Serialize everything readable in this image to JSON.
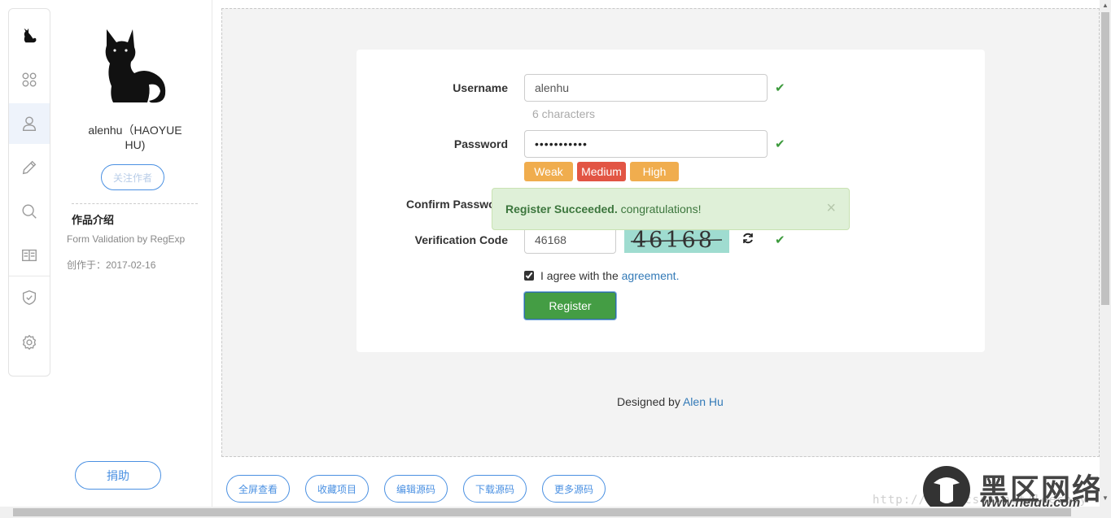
{
  "sidebar_icons": [
    "cat-logo-icon",
    "command-icon",
    "user-icon",
    "pencil-icon",
    "search-icon",
    "book-icon",
    "shield-check-icon",
    "gear-icon"
  ],
  "profile": {
    "name": "alenhu（HAOYUE HU)",
    "follow_label": "关注作者",
    "intro_title": "作品介绍",
    "intro_desc": "Form Validation by RegExp",
    "created": "创作于：2017-02-16",
    "donate_label": "捐助"
  },
  "form": {
    "username_label": "Username",
    "username_value": "alenhu",
    "username_help": "6 characters",
    "password_label": "Password",
    "password_value": "•••••••••••",
    "strength": [
      "Weak",
      "Medium",
      "High"
    ],
    "confirm_label": "Confirm Password",
    "verification_label": "Verification Code",
    "verification_value": "46168",
    "captcha_text": "46168",
    "agree_text": "I agree with the",
    "agree_link": "agreement",
    "agree_dot": ".",
    "register_label": "Register",
    "colors": {
      "success": "#3c9a3c",
      "weak": "#f0ad4e",
      "medium": "#e25544",
      "high": "#f0ad4e",
      "primary": "#449d44",
      "link": "#337ab7"
    }
  },
  "alert": {
    "strong": "Register Succeeded.",
    "text": " congratulations!",
    "close": "×"
  },
  "footer": {
    "designed_by": "Designed by",
    "author": "Alen Hu"
  },
  "bottom_buttons": [
    "全屏查看",
    "收藏项目",
    "编辑源码",
    "下载源码",
    "更多源码"
  ],
  "watermark": {
    "url": "http://blog.csdn.net/leechoy",
    "name": "黑区网络",
    "domain": "www.heiqu.com"
  }
}
